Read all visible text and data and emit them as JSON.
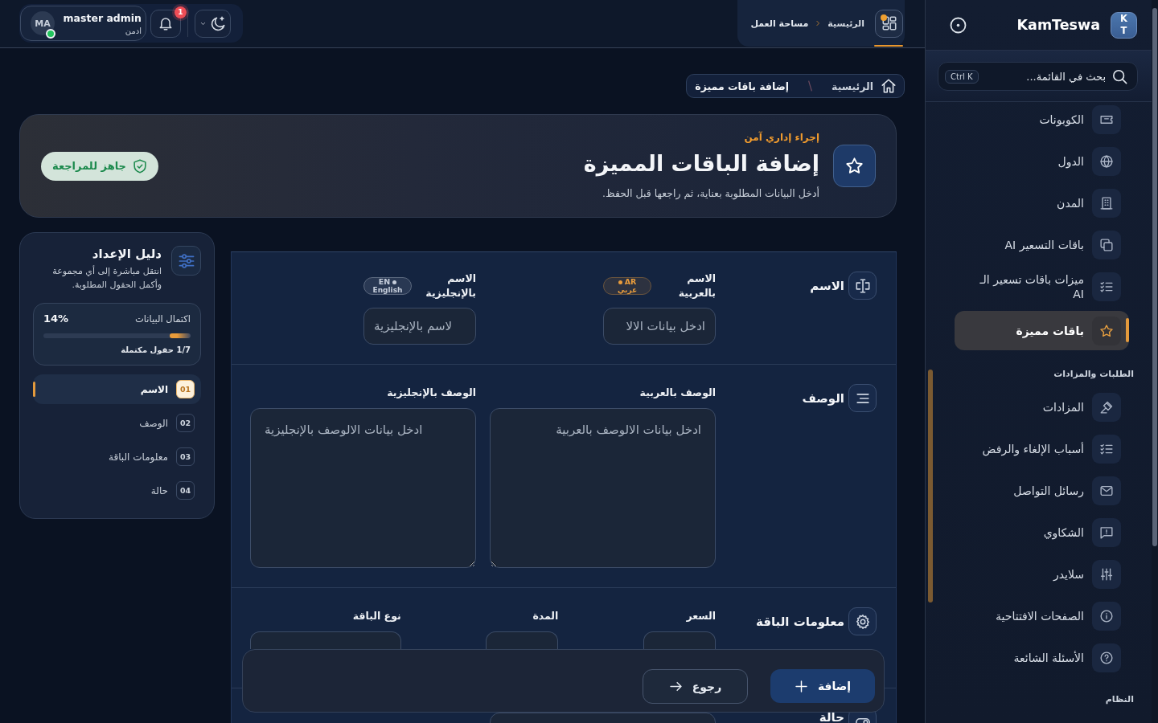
{
  "topbar": {
    "user": {
      "initials": "MA",
      "name": "master admin",
      "role": "ادمن",
      "online": true
    },
    "notifications": {
      "count": "1"
    },
    "breadcrumb": [
      {
        "label": "الرئيسية"
      },
      {
        "label": "مساحة العمل"
      }
    ]
  },
  "sidebar": {
    "logo": "K T",
    "brand": "KamTeswa",
    "search": {
      "placeholder": "بحث في القائمة...",
      "shortcut": "Ctrl K"
    },
    "groups": [
      {
        "items": [
          {
            "label": "الكوبونات",
            "selected": false
          },
          {
            "label": "الدول",
            "selected": false
          },
          {
            "label": "المدن",
            "selected": false
          },
          {
            "label": "باقات التسعير AI",
            "selected": false
          },
          {
            "label": "ميزات باقات تسعير الـ AI",
            "selected": false
          },
          {
            "label": "باقات مميزة",
            "selected": true
          }
        ]
      },
      {
        "title": "الطلبات والمزادات",
        "items": [
          {
            "label": "المزادات",
            "selected": false
          },
          {
            "label": "أسباب الإلغاء والرفض",
            "selected": false
          },
          {
            "label": "رسائل التواصل",
            "selected": false
          },
          {
            "label": "الشكاوي",
            "selected": false
          },
          {
            "label": "سلايدر",
            "selected": false
          },
          {
            "label": "الصفحات الافتتاحية",
            "selected": false
          },
          {
            "label": "الأسئلة الشائعة",
            "selected": false
          }
        ]
      },
      {
        "title": "النظام"
      }
    ]
  },
  "header": {
    "breadcrumb": [
      {
        "label": "الرئيسية"
      },
      {
        "label": "إضافة باقات مميزة"
      }
    ],
    "eyebrow": "إجراء إداري آمن",
    "title": "إضافة الباقات المميزة",
    "subtitle": "أدخل البيانات المطلوبة بعناية، ثم راجعها قبل الحفظ.",
    "status": "جاهز للمراجعة"
  },
  "guide": {
    "title": "دليل الإعداد",
    "description": "انتقل مباشرة إلى أي مجموعة وأكمل الحقول المطلوبة.",
    "progress": {
      "label": "اكتمال البيانات",
      "percent": "14%",
      "level": 0.14,
      "caption": "1/7 حقول مكتملة"
    },
    "steps": [
      {
        "number": "01",
        "label": "الاسم",
        "selected": true
      },
      {
        "number": "02",
        "label": "الوصف",
        "selected": false
      },
      {
        "number": "03",
        "label": "معلومات الباقة",
        "selected": false
      },
      {
        "number": "04",
        "label": "حالة",
        "selected": false
      }
    ]
  },
  "form": {
    "sections": [
      {
        "title": "الاسم",
        "fields": [
          {
            "kind": "text",
            "label": "الاسم بالعربية",
            "badge": {
              "code": "AR",
              "language": "عربي",
              "color": "#e89c3c"
            },
            "placeholder": "ادخل بيانات الالا"
          },
          {
            "kind": "text",
            "label": "الاسم بالإنجليزية",
            "badge": {
              "code": "EN",
              "language": "English",
              "color": "#c6cedb"
            },
            "placeholder": "لاسم بالإنجليزية"
          }
        ]
      },
      {
        "title": "الوصف",
        "fields": [
          {
            "kind": "textarea",
            "label": "الوصف بالعربية",
            "placeholder": "ادخل بيانات الالوصف بالعربية"
          },
          {
            "kind": "textarea",
            "label": "الوصف بالإنجليزية",
            "placeholder": "ادخل بيانات الالوصف بالإنجليزية"
          }
        ]
      },
      {
        "title": "معلومات الباقة",
        "fields": [
          {
            "kind": "number",
            "label": "السعر"
          },
          {
            "kind": "number",
            "label": "المدة"
          },
          {
            "kind": "wide",
            "label": "نوع الباقة"
          }
        ]
      },
      {
        "title": "حالة",
        "fields": [
          {
            "kind": "wide"
          }
        ]
      }
    ]
  },
  "actions": [
    {
      "kind": "primary",
      "label": "إضافة"
    },
    {
      "kind": "secondary",
      "label": "رجوع"
    }
  ]
}
